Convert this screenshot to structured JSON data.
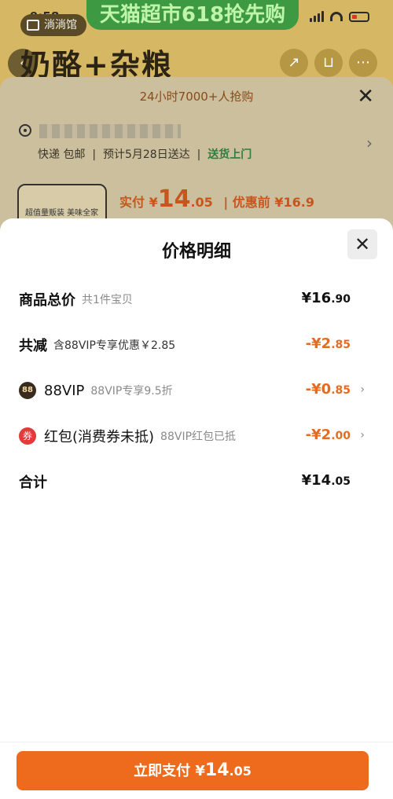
{
  "background": {
    "banner_text": "天猫超市618抢先购",
    "store_label": "淌淌馆",
    "time": "9:58",
    "title": "奶酪+杂粮",
    "rush_text": "24小时7000+人抢购",
    "shipping": {
      "method": "快递 包邮",
      "eta": "预计5月28日送达",
      "door": "送货上门"
    },
    "thumb_text": "超值量贩装 美味全家享",
    "price": {
      "label": "实付 ¥",
      "int": "14",
      "dec": ".05",
      "before": "| 优惠前 ¥16.9"
    }
  },
  "modal": {
    "title": "价格明细",
    "rows": [
      {
        "label": "商品总价",
        "sub": "共1件宝贝",
        "amount_int": "¥16",
        "amount_dec": ".90"
      },
      {
        "label": "共减",
        "sub": "含88VIP专享优惠￥2.85",
        "amount_int": "-¥2",
        "amount_dec": ".85"
      },
      {
        "icon_text": "88",
        "label": "88VIP",
        "sub": "88VIP专享9.5折",
        "amount_int": "-¥0",
        "amount_dec": ".85"
      },
      {
        "icon_text": "券",
        "label": "红包(消费券未抵)",
        "sub": "88VIP红包已抵",
        "amount_int": "-¥2",
        "amount_dec": ".00"
      },
      {
        "label": "合计",
        "sub": "",
        "amount_int": "¥14",
        "amount_dec": ".05"
      }
    ],
    "pay_button": {
      "prefix": "立即支付 ¥",
      "int": "14",
      "dec": ".05"
    }
  },
  "icons": [
    "back-icon",
    "share-icon",
    "cart-icon",
    "more-icon",
    "close-icon",
    "location-pin-icon",
    "chevron-right-icon",
    "vip88-icon",
    "red-packet-icon"
  ],
  "colors": {
    "accent": "#ee6a1d",
    "discount": "#e66b21",
    "green": "#2e7d43"
  }
}
